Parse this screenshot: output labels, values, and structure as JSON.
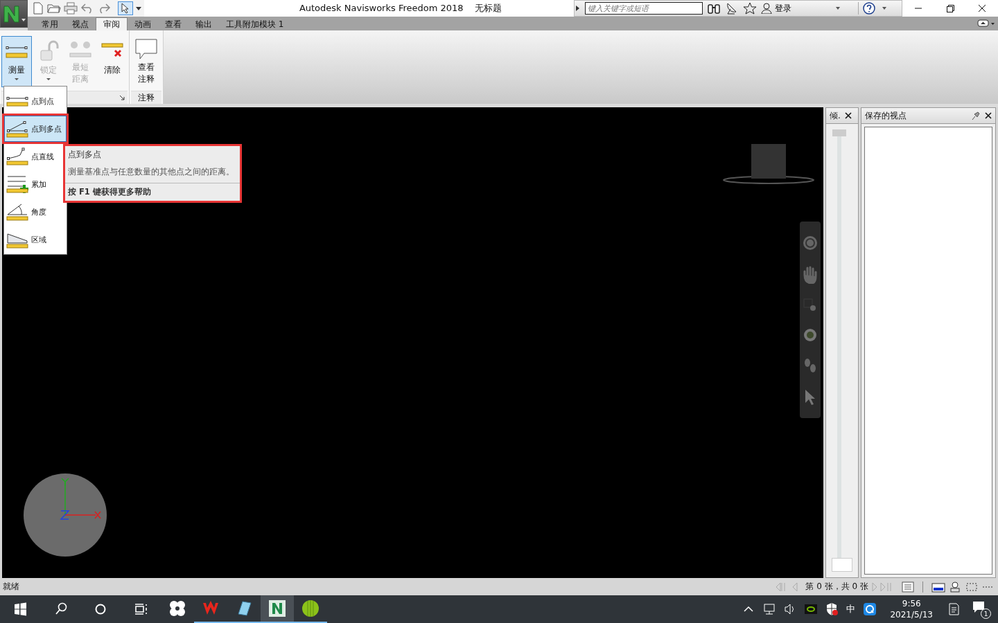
{
  "window": {
    "title": "Autodesk Navisworks Freedom 2018",
    "document": "无标题"
  },
  "search": {
    "placeholder": "键入关键字或短语"
  },
  "sign_in": "登录",
  "tabs": [
    {
      "label": "常用",
      "selected": false
    },
    {
      "label": "视点",
      "selected": false
    },
    {
      "label": "审阅",
      "selected": true
    },
    {
      "label": "动画",
      "selected": false
    },
    {
      "label": "查看",
      "selected": false
    },
    {
      "label": "输出",
      "selected": false
    },
    {
      "label": "工具附加模块 1",
      "selected": false
    }
  ],
  "ribbon": {
    "panels": [
      {
        "buttons": [
          {
            "label": "测量",
            "kind": "measure",
            "pressed": true,
            "disabled": false
          },
          {
            "label": "锁定",
            "kind": "lock",
            "pressed": false,
            "disabled": true
          },
          {
            "label": "最短距离",
            "kind": "shortest",
            "pressed": false,
            "disabled": true
          },
          {
            "label": "清除",
            "kind": "clear",
            "pressed": false,
            "disabled": false
          }
        ]
      },
      {
        "label": "注释",
        "buttons": [
          {
            "label": "查看注释",
            "kind": "comments",
            "pressed": false,
            "disabled": false
          }
        ]
      }
    ]
  },
  "measure_menu": [
    {
      "label": "点到点",
      "kind": "point_to_point",
      "selected": false
    },
    {
      "label": "点到多点",
      "kind": "point_to_multiple",
      "selected": true
    },
    {
      "label": "点直线",
      "kind": "point_line",
      "selected": false
    },
    {
      "label": "累加",
      "kind": "accumulate",
      "selected": false
    },
    {
      "label": "角度",
      "kind": "angle",
      "selected": false
    },
    {
      "label": "区域",
      "kind": "area",
      "selected": false
    }
  ],
  "tooltip": {
    "title": "点到多点",
    "description": "测量基准点与任意数量的其他点之间的距离。",
    "help": "按 F1 键获得更多帮助"
  },
  "tilt_panel": {
    "title": "倾.",
    "level": 0
  },
  "saved_viewpoints": {
    "title": "保存的视点"
  },
  "status_bar": {
    "text": "就绪",
    "page_info": "第 0 张，共 0 张"
  },
  "taskbar": {
    "apps": [
      {
        "kind": "pinwheel",
        "running": false,
        "active": false
      },
      {
        "kind": "wps",
        "running": true,
        "active": false
      },
      {
        "kind": "notepad",
        "running": true,
        "active": false
      },
      {
        "kind": "navisworks",
        "running": true,
        "active": true
      },
      {
        "kind": "ball",
        "running": true,
        "active": false
      }
    ],
    "ime": "中",
    "time": "9:56",
    "date": "2021/5/13",
    "notifications": "1"
  }
}
